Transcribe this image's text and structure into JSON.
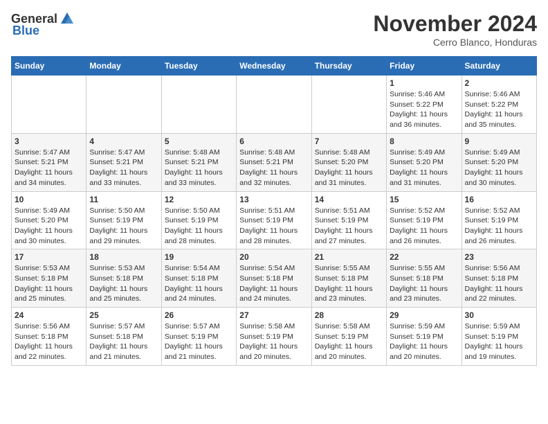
{
  "header": {
    "logo_general": "General",
    "logo_blue": "Blue",
    "month_title": "November 2024",
    "subtitle": "Cerro Blanco, Honduras"
  },
  "days_of_week": [
    "Sunday",
    "Monday",
    "Tuesday",
    "Wednesday",
    "Thursday",
    "Friday",
    "Saturday"
  ],
  "weeks": [
    [
      {
        "day": "",
        "info": ""
      },
      {
        "day": "",
        "info": ""
      },
      {
        "day": "",
        "info": ""
      },
      {
        "day": "",
        "info": ""
      },
      {
        "day": "",
        "info": ""
      },
      {
        "day": "1",
        "info": "Sunrise: 5:46 AM\nSunset: 5:22 PM\nDaylight: 11 hours and 36 minutes."
      },
      {
        "day": "2",
        "info": "Sunrise: 5:46 AM\nSunset: 5:22 PM\nDaylight: 11 hours and 35 minutes."
      }
    ],
    [
      {
        "day": "3",
        "info": "Sunrise: 5:47 AM\nSunset: 5:21 PM\nDaylight: 11 hours and 34 minutes."
      },
      {
        "day": "4",
        "info": "Sunrise: 5:47 AM\nSunset: 5:21 PM\nDaylight: 11 hours and 33 minutes."
      },
      {
        "day": "5",
        "info": "Sunrise: 5:48 AM\nSunset: 5:21 PM\nDaylight: 11 hours and 33 minutes."
      },
      {
        "day": "6",
        "info": "Sunrise: 5:48 AM\nSunset: 5:21 PM\nDaylight: 11 hours and 32 minutes."
      },
      {
        "day": "7",
        "info": "Sunrise: 5:48 AM\nSunset: 5:20 PM\nDaylight: 11 hours and 31 minutes."
      },
      {
        "day": "8",
        "info": "Sunrise: 5:49 AM\nSunset: 5:20 PM\nDaylight: 11 hours and 31 minutes."
      },
      {
        "day": "9",
        "info": "Sunrise: 5:49 AM\nSunset: 5:20 PM\nDaylight: 11 hours and 30 minutes."
      }
    ],
    [
      {
        "day": "10",
        "info": "Sunrise: 5:49 AM\nSunset: 5:20 PM\nDaylight: 11 hours and 30 minutes."
      },
      {
        "day": "11",
        "info": "Sunrise: 5:50 AM\nSunset: 5:19 PM\nDaylight: 11 hours and 29 minutes."
      },
      {
        "day": "12",
        "info": "Sunrise: 5:50 AM\nSunset: 5:19 PM\nDaylight: 11 hours and 28 minutes."
      },
      {
        "day": "13",
        "info": "Sunrise: 5:51 AM\nSunset: 5:19 PM\nDaylight: 11 hours and 28 minutes."
      },
      {
        "day": "14",
        "info": "Sunrise: 5:51 AM\nSunset: 5:19 PM\nDaylight: 11 hours and 27 minutes."
      },
      {
        "day": "15",
        "info": "Sunrise: 5:52 AM\nSunset: 5:19 PM\nDaylight: 11 hours and 26 minutes."
      },
      {
        "day": "16",
        "info": "Sunrise: 5:52 AM\nSunset: 5:19 PM\nDaylight: 11 hours and 26 minutes."
      }
    ],
    [
      {
        "day": "17",
        "info": "Sunrise: 5:53 AM\nSunset: 5:18 PM\nDaylight: 11 hours and 25 minutes."
      },
      {
        "day": "18",
        "info": "Sunrise: 5:53 AM\nSunset: 5:18 PM\nDaylight: 11 hours and 25 minutes."
      },
      {
        "day": "19",
        "info": "Sunrise: 5:54 AM\nSunset: 5:18 PM\nDaylight: 11 hours and 24 minutes."
      },
      {
        "day": "20",
        "info": "Sunrise: 5:54 AM\nSunset: 5:18 PM\nDaylight: 11 hours and 24 minutes."
      },
      {
        "day": "21",
        "info": "Sunrise: 5:55 AM\nSunset: 5:18 PM\nDaylight: 11 hours and 23 minutes."
      },
      {
        "day": "22",
        "info": "Sunrise: 5:55 AM\nSunset: 5:18 PM\nDaylight: 11 hours and 23 minutes."
      },
      {
        "day": "23",
        "info": "Sunrise: 5:56 AM\nSunset: 5:18 PM\nDaylight: 11 hours and 22 minutes."
      }
    ],
    [
      {
        "day": "24",
        "info": "Sunrise: 5:56 AM\nSunset: 5:18 PM\nDaylight: 11 hours and 22 minutes."
      },
      {
        "day": "25",
        "info": "Sunrise: 5:57 AM\nSunset: 5:18 PM\nDaylight: 11 hours and 21 minutes."
      },
      {
        "day": "26",
        "info": "Sunrise: 5:57 AM\nSunset: 5:19 PM\nDaylight: 11 hours and 21 minutes."
      },
      {
        "day": "27",
        "info": "Sunrise: 5:58 AM\nSunset: 5:19 PM\nDaylight: 11 hours and 20 minutes."
      },
      {
        "day": "28",
        "info": "Sunrise: 5:58 AM\nSunset: 5:19 PM\nDaylight: 11 hours and 20 minutes."
      },
      {
        "day": "29",
        "info": "Sunrise: 5:59 AM\nSunset: 5:19 PM\nDaylight: 11 hours and 20 minutes."
      },
      {
        "day": "30",
        "info": "Sunrise: 5:59 AM\nSunset: 5:19 PM\nDaylight: 11 hours and 19 minutes."
      }
    ]
  ]
}
